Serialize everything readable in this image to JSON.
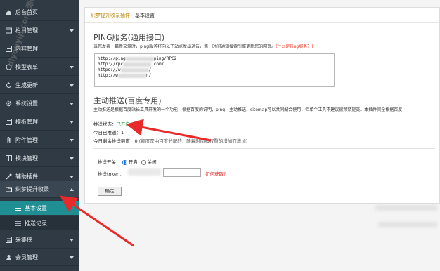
{
  "sidebar": {
    "items": [
      {
        "label": "后台首页",
        "icon": "home-icon"
      },
      {
        "label": "栏目管理",
        "icon": "columns-icon"
      },
      {
        "label": "内容管理",
        "icon": "content-icon"
      },
      {
        "label": "模型表单",
        "icon": "model-icon"
      },
      {
        "label": "生成更新",
        "icon": "refresh-icon"
      },
      {
        "label": "系统设置",
        "icon": "gear-icon"
      },
      {
        "label": "模板管理",
        "icon": "template-icon"
      },
      {
        "label": "附件管理",
        "icon": "paperclip-icon"
      },
      {
        "label": "模块管理",
        "icon": "module-icon"
      },
      {
        "label": "辅助插件",
        "icon": "plugin-icon"
      },
      {
        "label": "织梦提升收录",
        "icon": "folder-icon"
      },
      {
        "label": "基本设置",
        "icon": "list-icon"
      },
      {
        "label": "推送记录",
        "icon": "list-icon"
      },
      {
        "label": "采集侠",
        "icon": "collector-icon"
      },
      {
        "label": "会员管理",
        "icon": "user-icon"
      }
    ]
  },
  "breadcrumb": {
    "app": "织梦提升收录插件",
    "sep": " - ",
    "page": "基本设置"
  },
  "ping": {
    "title": "PING服务(通用接口)",
    "desc": "当您发表一篇新文章时，ping服务将向以下站点发出通告，第一时间通知搜索引擎更新您的网页。",
    "link": "(什么是Ping服务？)",
    "lines": [
      "http://ping",
      "ping/RPC2",
      "http://rpc",
      ".com/",
      "https://w",
      "/",
      "http://w",
      "n/"
    ]
  },
  "push": {
    "title": "主动推送(百度专用)",
    "desc": "主动推送是根据百度站长工具开发的一个功能，根据百度的说明，ping、主动推送、sitemap可以共同配合使用，但单个工具不建议很频繁提交。本插件完全根据百度",
    "status_label": "推送状态：",
    "status_value": "已开启",
    "today_label": "今日已推送：",
    "today_value": "1",
    "remain_label": "今日剩余推送额度：",
    "remain_value": "0",
    "remain_note": "(额度是由百度分配的，随着时间和权重的增加而增加)"
  },
  "form": {
    "switch_label": "推送开关：",
    "opt_on": "开启",
    "opt_off": "关闭",
    "token_label": "推送token：",
    "token_link": "如何获取?",
    "submit": "确定"
  },
  "watermark": "dlyouyip.com 源码网综合资源",
  "colors": {
    "sidebar_bg": "#2f3a44",
    "active": "#24a0a6",
    "link_red": "#e32222",
    "status_green": "#1a9e2a"
  }
}
